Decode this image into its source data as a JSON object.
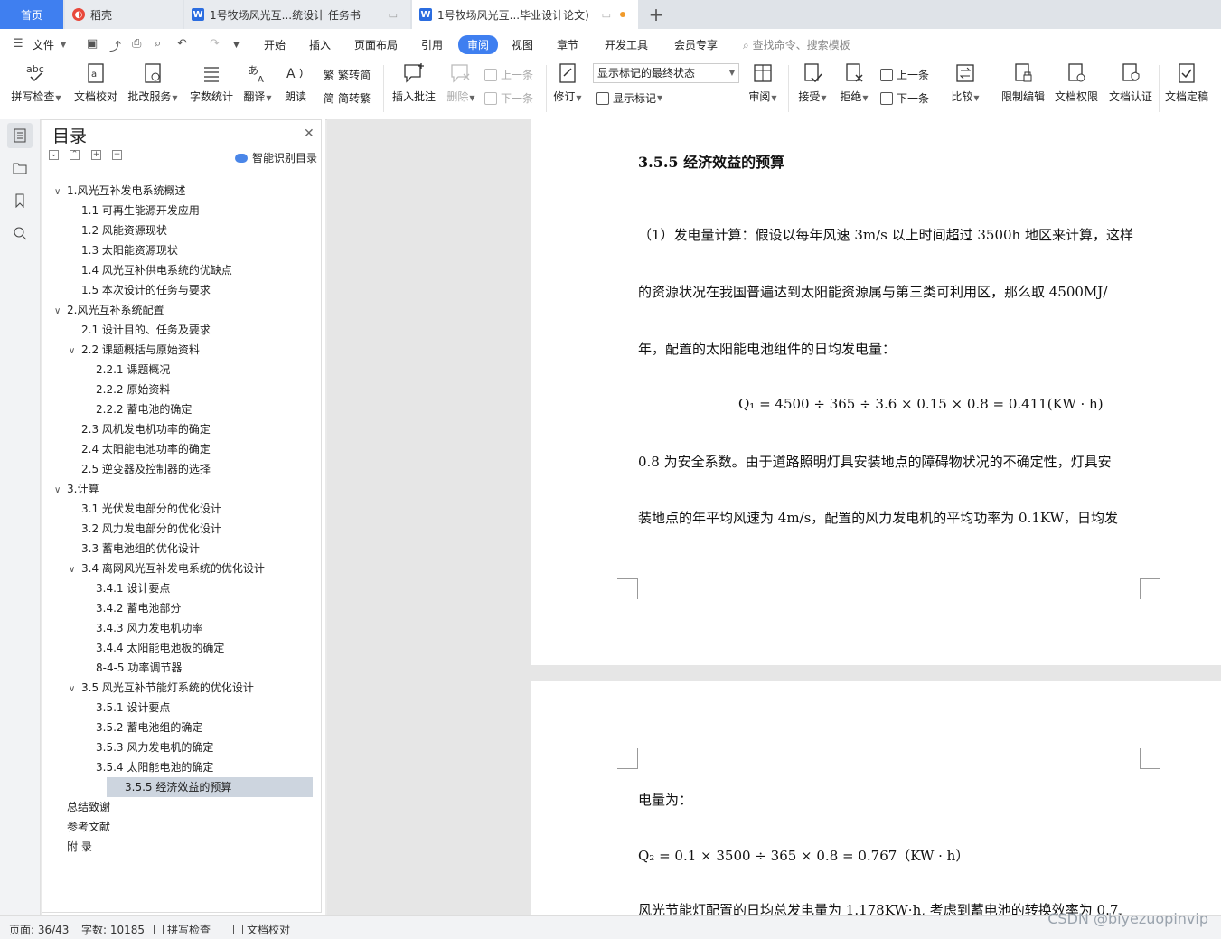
{
  "tabs": [
    {
      "label": "首页"
    },
    {
      "label": "稻壳"
    },
    {
      "label": "1号牧场风光互...统设计 任务书"
    },
    {
      "label": "1号牧场风光互...毕业设计论文)"
    }
  ],
  "menu": {
    "file": "文件",
    "items": [
      "开始",
      "插入",
      "页面布局",
      "引用",
      "审阅",
      "视图",
      "章节",
      "开发工具",
      "会员专享"
    ],
    "active": "审阅",
    "search_placeholder": "查找命令、搜索模板"
  },
  "ribbon": {
    "spell_check": "拼写检查",
    "doc_proof": "文档校对",
    "review_service": "批改服务",
    "word_count": "字数统计",
    "translate": "翻译",
    "read_aloud": "朗读",
    "to_traditional": "繁转简",
    "to_simplified": "简转繁",
    "insert_comment": "插入批注",
    "delete": "删除",
    "prev_comment": "上一条",
    "next_comment": "下一条",
    "track_changes": "修订",
    "markup_state": "显示标记的最终状态",
    "show_markup": "显示标记",
    "review": "审阅",
    "accept": "接受",
    "reject": "拒绝",
    "prev_change": "上一条",
    "next_change": "下一条",
    "compare": "比较",
    "restrict_edit": "限制编辑",
    "doc_permission": "文档权限",
    "doc_cert": "文档认证",
    "doc_finalize": "文档定稿"
  },
  "toc": {
    "title": "目录",
    "smart": "智能识别目录",
    "items": [
      {
        "text": "1.风光互补发电系统概述",
        "level": 1,
        "arrow": "∨"
      },
      {
        "text": "1.1  可再生能源开发应用",
        "level": 2
      },
      {
        "text": "1.2  风能资源现状",
        "level": 2
      },
      {
        "text": "1.3  太阳能资源现状",
        "level": 2
      },
      {
        "text": "1.4  风光互补供电系统的优缺点",
        "level": 2
      },
      {
        "text": "1.5 本次设计的任务与要求",
        "level": 2
      },
      {
        "text": "2.风光互补系统配置",
        "level": 1,
        "arrow": "∨"
      },
      {
        "text": "2.1 设计目的、任务及要求",
        "level": 2
      },
      {
        "text": "2.2 课题概括与原始资料",
        "level": 2,
        "arrow": "∨"
      },
      {
        "text": "2.2.1 课题概况",
        "level": 3
      },
      {
        "text": "2.2.2 原始资料",
        "level": 3
      },
      {
        "text": "2.2.2 蓄电池的确定",
        "level": 3
      },
      {
        "text": "2.3 风机发电机功率的确定",
        "level": 2
      },
      {
        "text": "2.4 太阳能电池功率的确定",
        "level": 2
      },
      {
        "text": "2.5 逆变器及控制器的选择",
        "level": 2
      },
      {
        "text": "3.计算",
        "level": 1,
        "arrow": "∨"
      },
      {
        "text": "3.1 光伏发电部分的优化设计",
        "level": 2
      },
      {
        "text": "3.2 风力发电部分的优化设计",
        "level": 2
      },
      {
        "text": "3.3 蓄电池组的优化设计",
        "level": 2
      },
      {
        "text": "3.4  离网风光互补发电系统的优化设计",
        "level": 2,
        "arrow": "∨"
      },
      {
        "text": "3.4.1 设计要点",
        "level": 3
      },
      {
        "text": "3.4.2 蓄电池部分",
        "level": 3
      },
      {
        "text": "3.4.3 风力发电机功率",
        "level": 3
      },
      {
        "text": "3.4.4 太阳能电池板的确定",
        "level": 3
      },
      {
        "text": "8-4-5 功率调节器",
        "level": 3
      },
      {
        "text": "3.5  风光互补节能灯系统的优化设计",
        "level": 2,
        "arrow": "∨"
      },
      {
        "text": "3.5.1 设计要点",
        "level": 3
      },
      {
        "text": "3.5.2 蓄电池组的确定",
        "level": 3
      },
      {
        "text": "3.5.3 风力发电机的确定",
        "level": 3
      },
      {
        "text": "3.5.4 太阳能电池的确定",
        "level": 3
      },
      {
        "text": "3.5.5 经济效益的预算",
        "level": 3,
        "selected": true
      },
      {
        "text": "总结致谢",
        "level": 1
      },
      {
        "text": "参考文献",
        "level": 1
      },
      {
        "text": "附  录",
        "level": 1
      }
    ]
  },
  "document": {
    "page1": {
      "heading": "3.5.5 经济效益的预算",
      "p1": "（1）发电量计算：假设以每年风速 3m/s 以上时间超过 3500h 地区来计算，这样",
      "p2": "的资源状况在我国普遍达到太阳能资源属与第三类可利用区，那么取 4500MJ/",
      "p3": "年，配置的太阳能电池组件的日均发电量：",
      "formula1": "Q₁ = 4500 ÷ 365 ÷ 3.6 × 0.15 × 0.8 = 0.411(KW · h)",
      "p4": "0.8 为安全系数。由于道路照明灯具安装地点的障碍物状况的不确定性，灯具安",
      "p5": "装地点的年平均风速为 4m/s，配置的风力发电机的平均功率为 0.1KW，日均发"
    },
    "page2": {
      "p1": "电量为：",
      "formula2": "Q₂ = 0.1 × 3500 ÷ 365 × 0.8 = 0.767（KW · h）",
      "p2": "风光节能灯配置的日均总发电量为 1.178KW·h, 考虑到蓄电池的转换效率为 0.7,"
    }
  },
  "status": {
    "page": "页面: 36/43",
    "words": "字数: 10185",
    "spell": "拼写检查",
    "proof": "文档校对",
    "watermark": "CSDN @biyezuopinvip"
  },
  "colors": {
    "accent": "#3f7ff0",
    "toc_selected": "#cdd5df",
    "tabbar": "#dfe3e8"
  }
}
